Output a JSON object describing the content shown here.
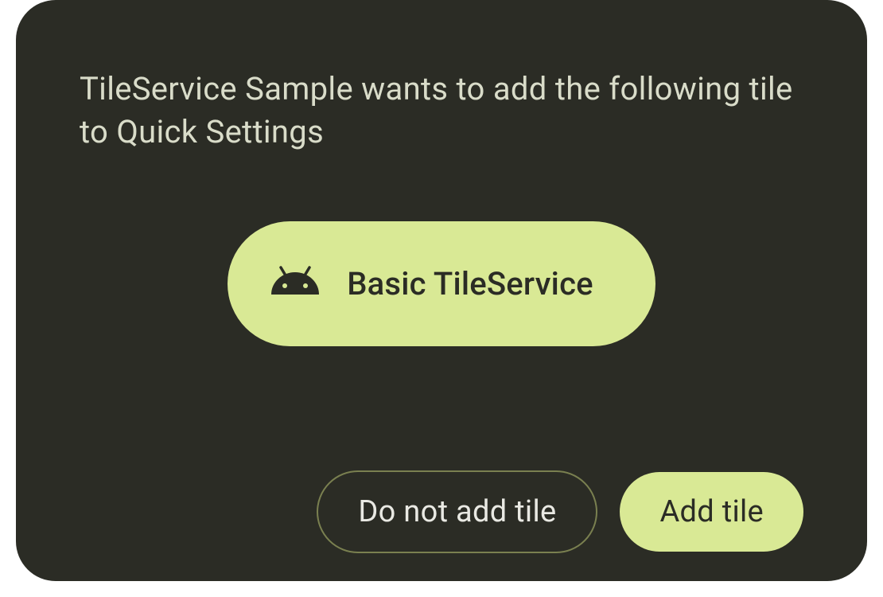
{
  "dialog": {
    "prompt": "TileService Sample wants to add the following tile to Quick Settings",
    "tile": {
      "label": "Basic TileService",
      "icon": "android-icon"
    },
    "actions": {
      "deny_label": "Do not add tile",
      "confirm_label": "Add tile"
    }
  },
  "colors": {
    "background": "#2b2c25",
    "accent": "#d9e995",
    "text_light": "#d9dcc9",
    "text_dark": "#2b2c25",
    "outline": "#7a8050"
  }
}
